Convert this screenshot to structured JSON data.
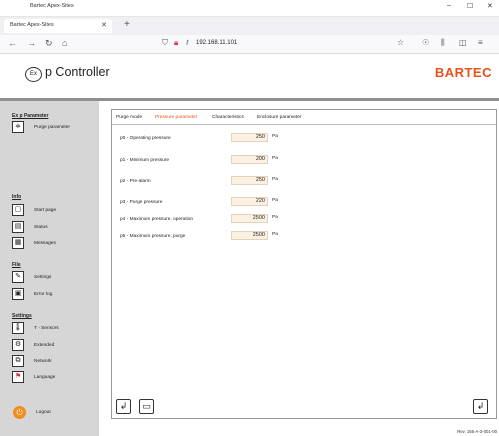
{
  "window": {
    "title": "Bartec Apex-Sites",
    "minimize": "–",
    "maximize": "☐",
    "close": "✕"
  },
  "browser": {
    "tab_title": "Bartec Apex-Sites",
    "tab_close": "✕",
    "new_tab": "+",
    "back": "←",
    "forward": "→",
    "reload": "↻",
    "home": "⌂",
    "url": "192.168.11.101",
    "bookmark_icon": "☆",
    "pocket_icon": "☉",
    "library_icon": "⫼",
    "sidebar_icon": "◫",
    "menu_icon": "≡"
  },
  "header": {
    "logo_text": "Ex",
    "title": "p Controller",
    "brand": "BARTEC"
  },
  "sidebar": {
    "sections": {
      "expurge": "Ex p Parameter",
      "info": "Info",
      "file": "File",
      "settings": "Settings"
    },
    "items": [
      {
        "label": "Purge parameter",
        "icon": "≑"
      },
      {
        "label": "Start page",
        "icon": "▢"
      },
      {
        "label": "Status",
        "icon": "▤"
      },
      {
        "label": "Messages",
        "icon": "▦"
      },
      {
        "label": "Settings",
        "icon": "✎"
      },
      {
        "label": "Error log",
        "icon": "▣"
      },
      {
        "label": "T - Sensors",
        "icon": "🌡"
      },
      {
        "label": "Extended",
        "icon": "⚙"
      },
      {
        "label": "Network",
        "icon": "⧉"
      },
      {
        "label": "Language",
        "icon": "⚑"
      }
    ],
    "logout": {
      "label": "Logout",
      "icon": "⏻"
    }
  },
  "tabs": [
    {
      "label": "Purge mode",
      "active": false
    },
    {
      "label": "Pressure parameter",
      "active": true
    },
    {
      "label": "Characteristics",
      "active": false
    },
    {
      "label": "Enclosure parameter",
      "active": false
    }
  ],
  "params": [
    {
      "label": "p0 - Operating pressure",
      "value": "250",
      "unit": "Pa"
    },
    {
      "label": "p1 - Minimum pressure",
      "value": "200",
      "unit": "Pa"
    },
    {
      "label": "p2 - Pre-alarm",
      "value": "250",
      "unit": "Pa"
    },
    {
      "label": "p3 - Purge pressure",
      "value": "220",
      "unit": "Pa"
    },
    {
      "label": "p4 - Maximum pressure, operation",
      "value": "2500",
      "unit": "Pa"
    },
    {
      "label": "p5 - Maximum pressure, purge",
      "value": "2500",
      "unit": "Pa"
    }
  ],
  "bottom_buttons": {
    "left1": "↲",
    "left2": "▭",
    "right": "↲"
  },
  "footer": {
    "rev": "Rev. 155-A-3-001-00"
  },
  "colors": {
    "accent": "#e8501c",
    "sidebar_bg": "#d6d6d6",
    "input_bg": "#fbf1e2",
    "logout": "#f28c1e"
  }
}
